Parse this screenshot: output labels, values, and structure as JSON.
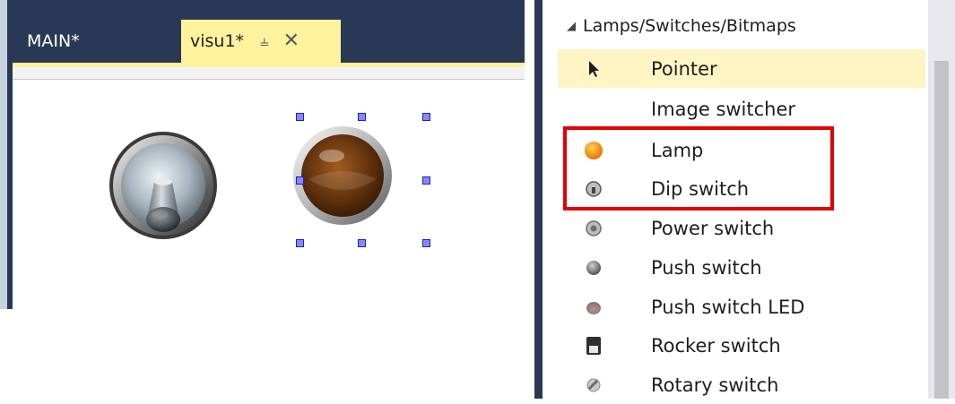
{
  "editor": {
    "tabs": [
      {
        "label": "MAIN*"
      },
      {
        "label": "visu1*",
        "pin": "⫨",
        "close": "✕"
      }
    ]
  },
  "toolbox": {
    "category": "Lamps/Switches/Bitmaps",
    "category_glyph": "◢",
    "items": [
      {
        "label": "Pointer",
        "icon": "pointer-icon"
      },
      {
        "label": "Image switcher",
        "icon": ""
      },
      {
        "label": "Lamp",
        "icon": "lamp-icon"
      },
      {
        "label": "Dip switch",
        "icon": "dip-switch-icon"
      },
      {
        "label": "Power switch",
        "icon": "power-switch-icon"
      },
      {
        "label": "Push switch",
        "icon": "push-switch-icon"
      },
      {
        "label": "Push switch LED",
        "icon": "push-switch-led-icon"
      },
      {
        "label": "Rocker switch",
        "icon": "rocker-switch-icon"
      },
      {
        "label": "Rotary switch",
        "icon": "rotary-switch-icon"
      }
    ]
  },
  "colors": {
    "frame": "#293955",
    "active_tab": "#fff29d",
    "selection": "#fff5c4",
    "highlight": "#e50000",
    "handle": "#8787ff"
  }
}
